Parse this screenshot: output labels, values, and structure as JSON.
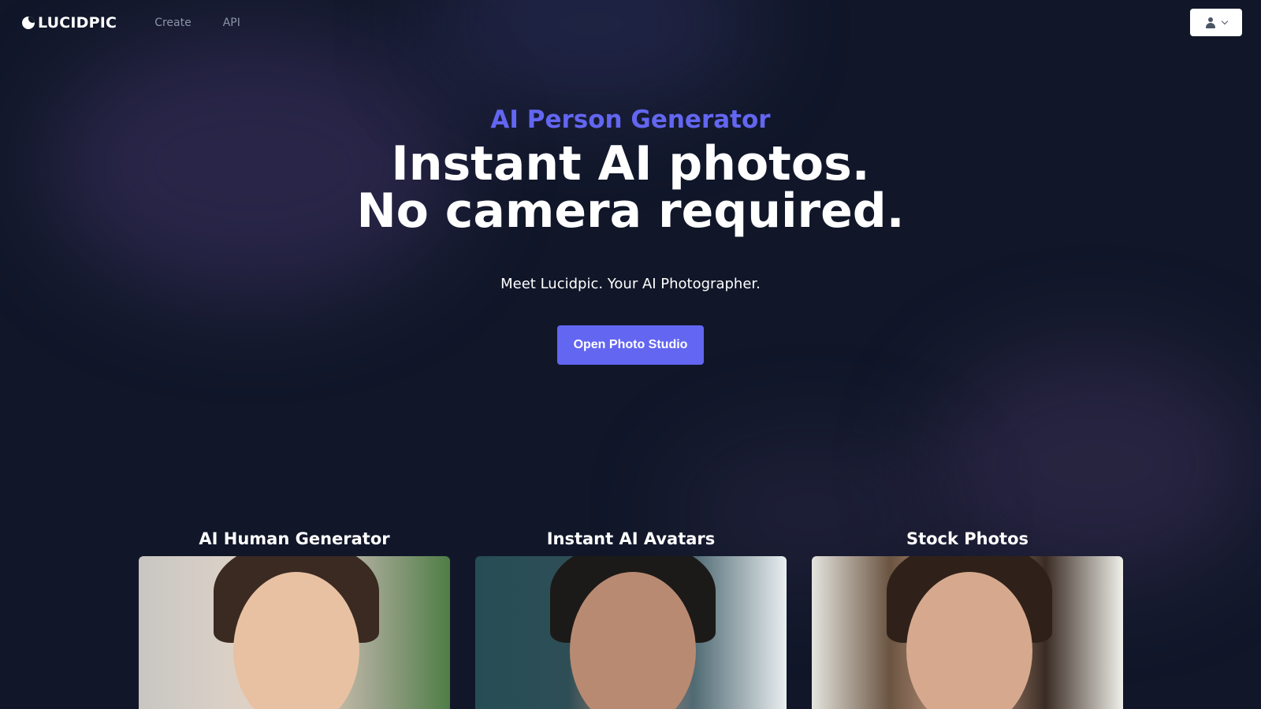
{
  "brand": {
    "name": "LUCIDPIC"
  },
  "nav": {
    "items": [
      {
        "label": "Create"
      },
      {
        "label": "API"
      }
    ]
  },
  "user_menu": {
    "icon": "user-icon",
    "chevron": "chevron-down-icon"
  },
  "hero": {
    "eyebrow": "AI Person Generator",
    "headline": "Instant AI photos. No camera required.",
    "subtitle": "Meet Lucidpic. Your AI Photographer.",
    "cta_label": "Open Photo Studio"
  },
  "cards": [
    {
      "title": "AI Human Generator"
    },
    {
      "title": "Instant AI Avatars"
    },
    {
      "title": "Stock Photos"
    }
  ],
  "colors": {
    "background": "#111729",
    "accent": "#6366f1",
    "nav_text": "#8b93a7"
  }
}
